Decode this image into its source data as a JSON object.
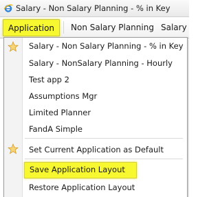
{
  "window": {
    "title": "Salary - Non Salary Planning - % in Key",
    "icon": "ie-browser-icon"
  },
  "menubar": {
    "items": [
      {
        "label": "Application"
      },
      {
        "label": "Non Salary Planning"
      },
      {
        "label": "Salary F"
      }
    ]
  },
  "dropdown": {
    "items": [
      {
        "label": "Salary - Non Salary Planning - % in Key",
        "icon": "star-icon"
      },
      {
        "label": "Salary - NonSalary Planning - Hourly"
      },
      {
        "label": "Test app 2"
      },
      {
        "label": "Assumptions Mgr"
      },
      {
        "label": "Limited Planner"
      },
      {
        "label": "FandA Simple"
      },
      {
        "label": "Set Current Application as Default",
        "icon": "star-icon"
      },
      {
        "label": "Save Application Layout"
      },
      {
        "label": "Restore Application Layout"
      }
    ]
  },
  "colors": {
    "highlight": "#f8f830"
  }
}
